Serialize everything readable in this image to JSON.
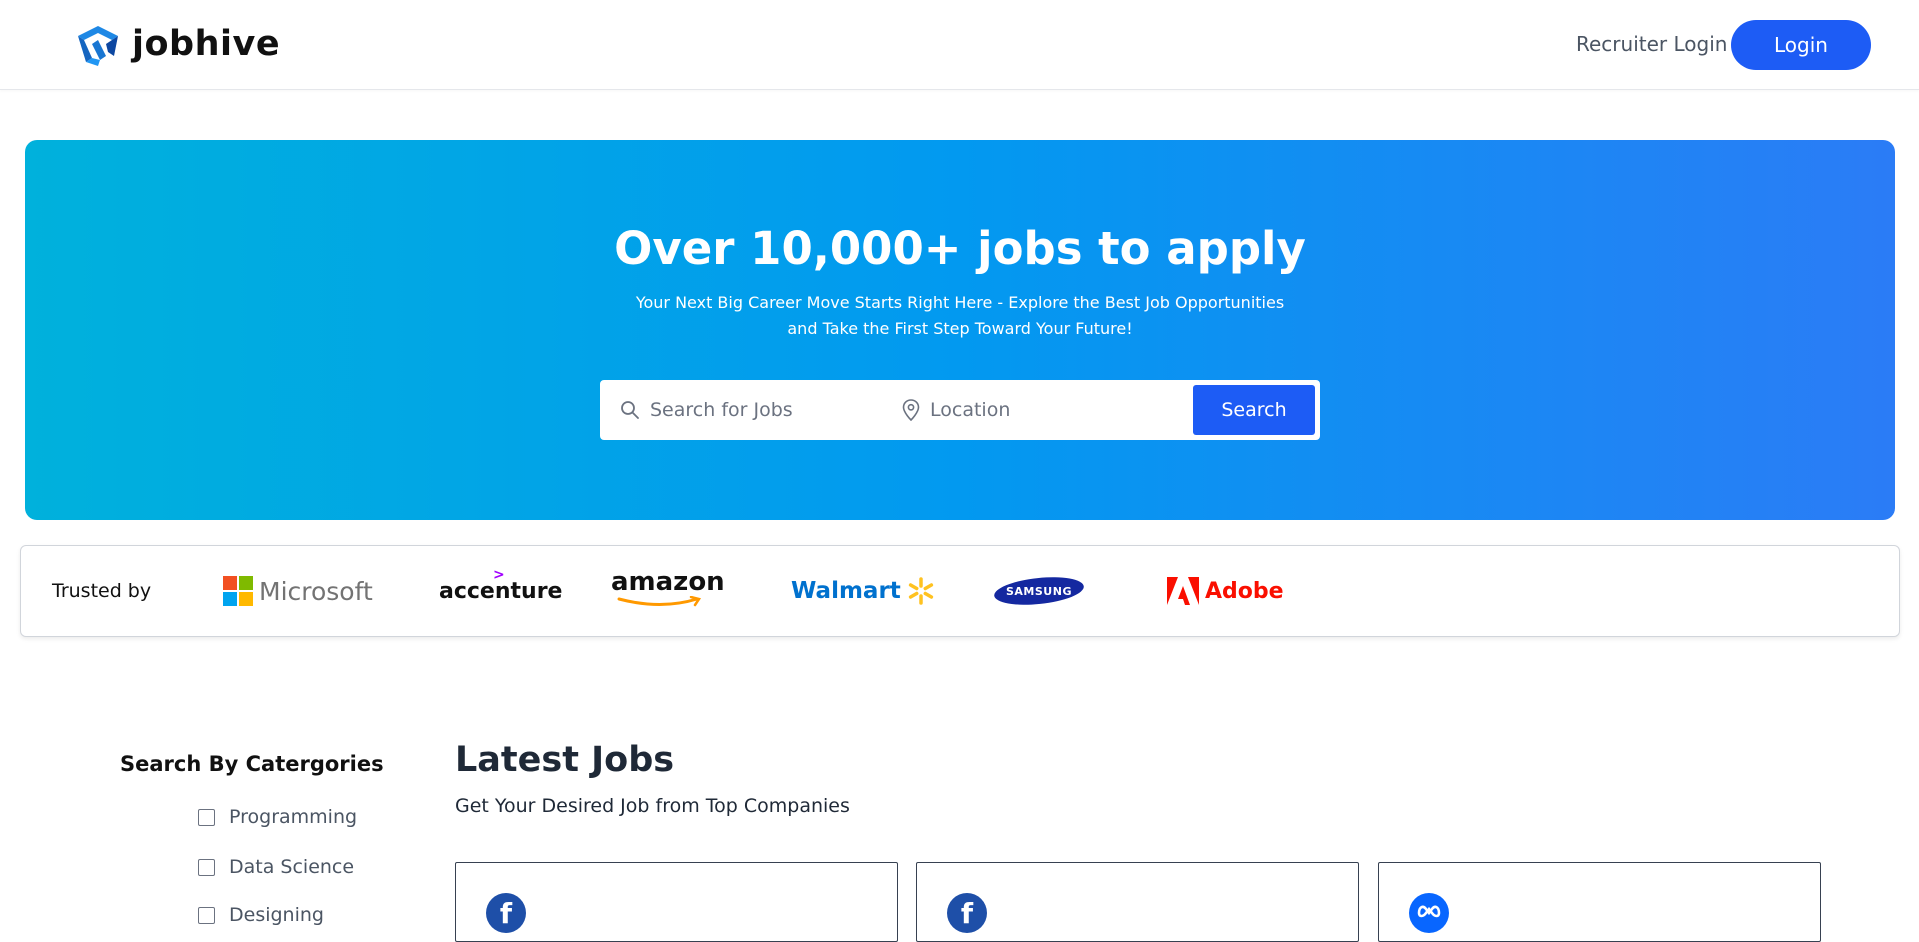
{
  "header": {
    "brand": "jobhive",
    "recruiter_login": "Recruiter Login",
    "login": "Login"
  },
  "hero": {
    "title": "Over 10,000+ jobs to apply",
    "subtitle": "Your Next Big Career Move Starts Right Here - Explore the Best Job Opportunities and Take the First Step Toward Your Future!",
    "search_placeholder": "Search for Jobs",
    "location_placeholder": "Location",
    "search_button": "Search"
  },
  "trusted": {
    "label": "Trusted by",
    "brands": [
      "Microsoft",
      "accenture",
      "amazon",
      "Walmart",
      "SAMSUNG",
      "Adobe"
    ]
  },
  "categories": {
    "title": "Search By Catergories",
    "items": [
      "Programming",
      "Data Science",
      "Designing"
    ]
  },
  "latest": {
    "title": "Latest Jobs",
    "subtitle": "Get Your Desired Job from Top Companies"
  },
  "colors": {
    "accent": "#1d5cf5",
    "hero_start": "#00b1dc",
    "hero_end": "#2b7cf6"
  }
}
